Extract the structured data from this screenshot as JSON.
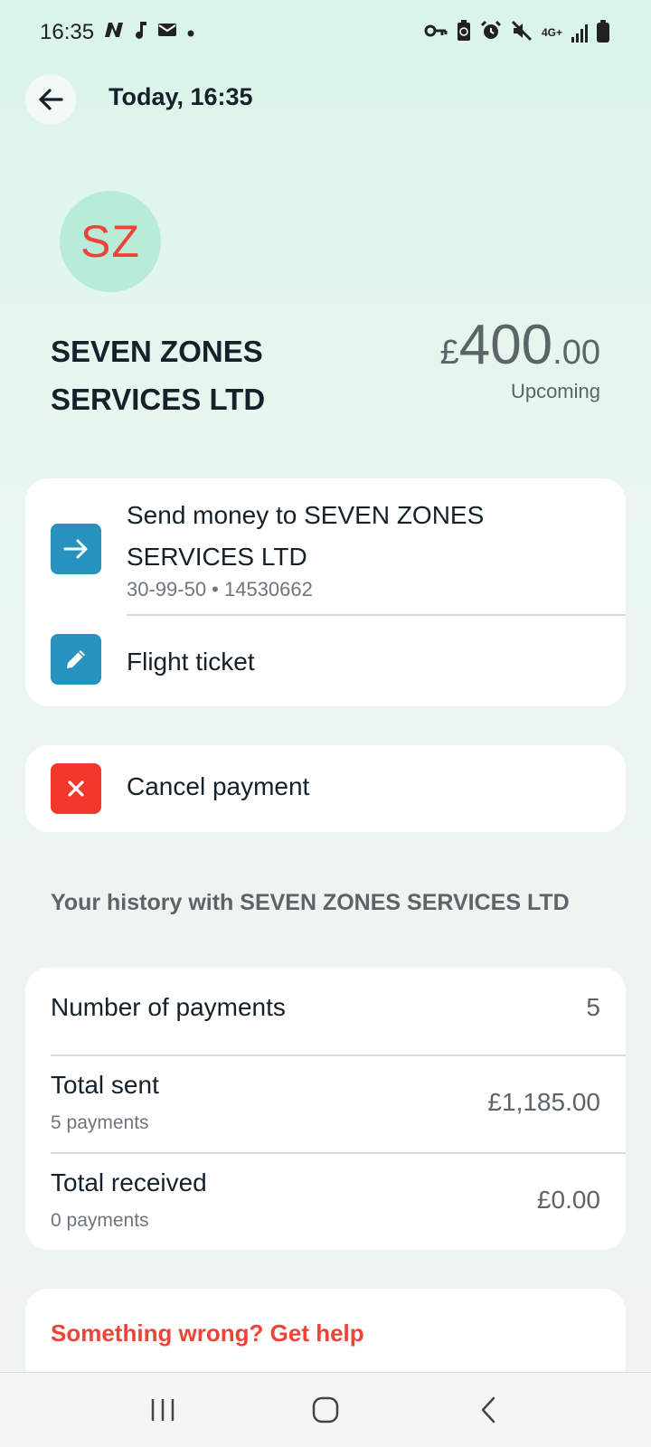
{
  "status_bar": {
    "time": "16:35",
    "network": "4G+",
    "left_icons": [
      "n-app-icon",
      "music-note-icon",
      "mail-icon",
      "dot-icon"
    ],
    "right_icons": [
      "key-icon",
      "battery-saver-icon",
      "alarm-icon",
      "mute-icon",
      "network-4g-icon",
      "signal-icon",
      "battery-icon"
    ]
  },
  "header": {
    "title": "Today, 16:35"
  },
  "payee": {
    "initials": "SZ",
    "name": "SEVEN ZONES SERVICES LTD",
    "avatar_bg": "#b8ecd9",
    "initials_color": "#ef4337"
  },
  "amount": {
    "currency": "£",
    "whole": "400",
    "decimal": ".00",
    "status": "Upcoming"
  },
  "details": {
    "send_label": "Send money to SEVEN ZONES SERVICES LTD",
    "account": "30-99-50 • 14530662",
    "reference": "Flight ticket",
    "accent": "#2792bd"
  },
  "cancel": {
    "label": "Cancel payment",
    "accent": "#f2382c"
  },
  "history": {
    "title": "Your history with SEVEN ZONES SERVICES LTD",
    "rows": [
      {
        "label": "Number of payments",
        "sub": "",
        "value": "5"
      },
      {
        "label": "Total sent",
        "sub": "5 payments",
        "value": "£1,185.00"
      },
      {
        "label": "Total received",
        "sub": "0 payments",
        "value": "£0.00"
      }
    ]
  },
  "help": {
    "label": "Something wrong? Get help",
    "color": "#ef4337"
  },
  "nav": {
    "buttons": [
      "recent-apps-icon",
      "home-icon",
      "back-nav-icon"
    ]
  }
}
